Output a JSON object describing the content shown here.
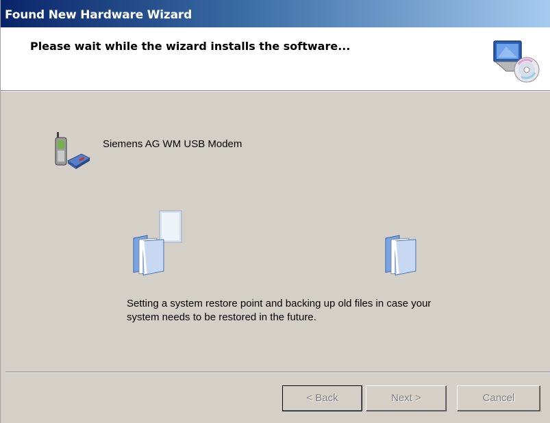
{
  "window": {
    "title": "Found New Hardware Wizard"
  },
  "header": {
    "heading": "Please wait while the wizard installs the software...",
    "icon": "hardware-cd-icon"
  },
  "device": {
    "name": "Siemens AG WM USB Modem",
    "icon": "mobile-modem-icon"
  },
  "progress": {
    "status": "Setting a system restore point and backing up old files in case your system needs to be restored in the future.",
    "source_icon": "folder-icon",
    "destination_icon": "folder-icon",
    "animation_icon": "document-icon"
  },
  "buttons": {
    "back": "< Back",
    "next": "Next >",
    "cancel": "Cancel"
  }
}
